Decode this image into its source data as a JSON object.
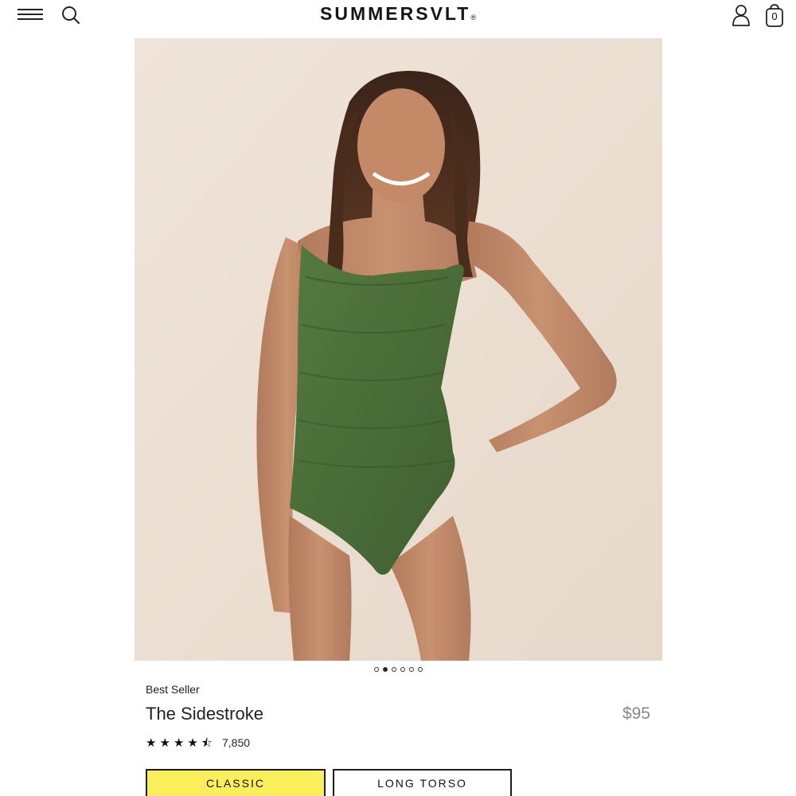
{
  "header": {
    "brand": "SUMMERSVLT",
    "brand_mark": "®",
    "cart_count": "0"
  },
  "hero": {
    "image_alt": "Model wearing green one-shoulder swimsuit",
    "carousel_slides": 6,
    "active_slide": 2
  },
  "product": {
    "badge": "Best Seller",
    "title": "The Sidestroke",
    "price": "$95",
    "rating_stars": "★★★★⯪",
    "rating_value": 4.5,
    "review_count": "7,850"
  },
  "fit_options": {
    "classic_label": "CLASSIC",
    "long_torso_label": "LONG TORSO",
    "selected": "CLASSIC"
  },
  "colors": {
    "selected_fit": "#fbee5c",
    "swimsuit": "#4a6b38",
    "backdrop": "#ecdfd2"
  }
}
